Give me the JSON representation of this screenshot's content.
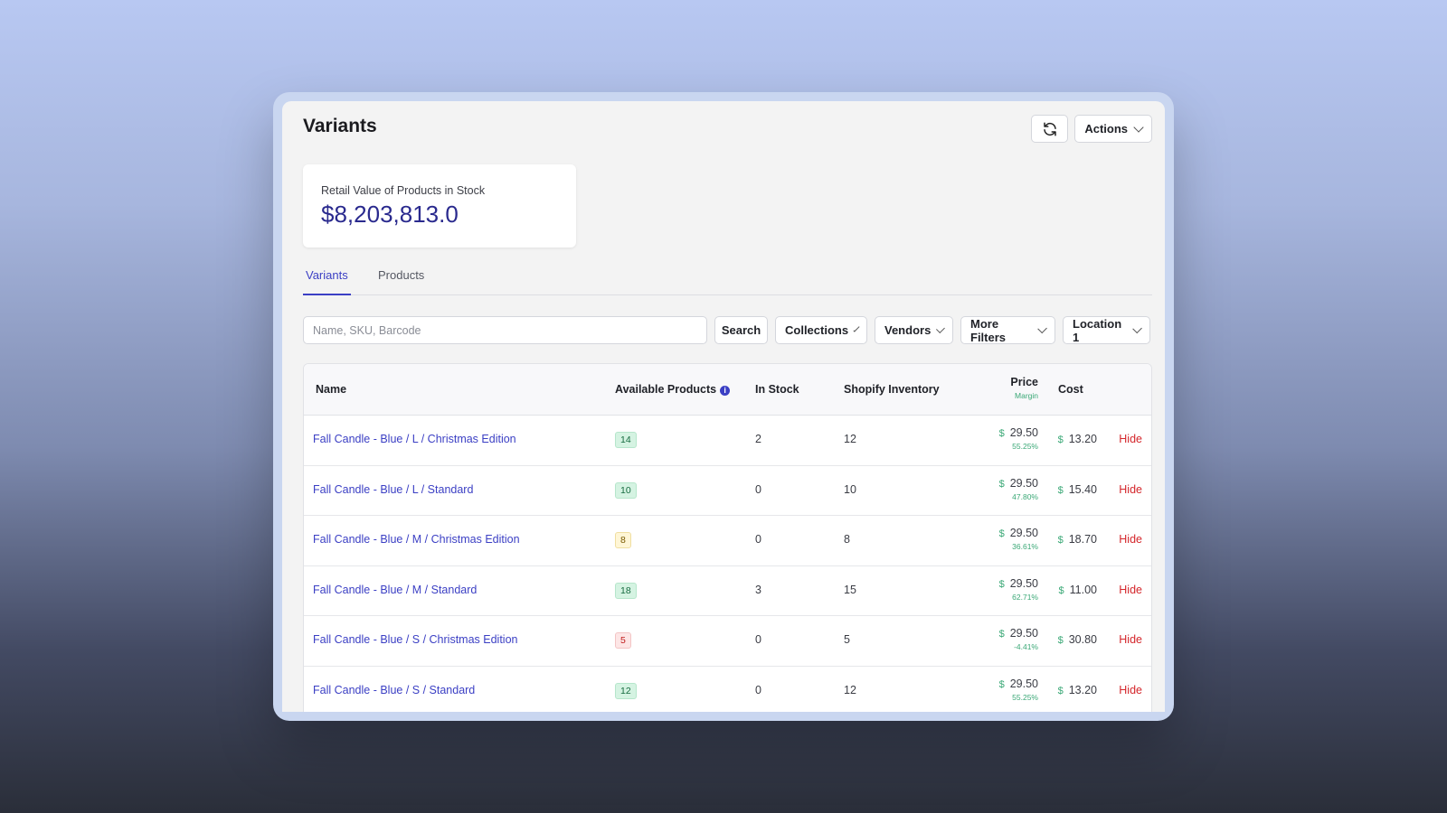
{
  "page": {
    "title": "Variants"
  },
  "toolbar": {
    "refresh_icon": "refresh-icon",
    "actions_label": "Actions"
  },
  "stat": {
    "label": "Retail Value of Products in Stock",
    "value": "$8,203,813.0"
  },
  "tabs": [
    {
      "label": "Variants",
      "active": true
    },
    {
      "label": "Products",
      "active": false
    }
  ],
  "filters": {
    "search_placeholder": "Name, SKU, Barcode",
    "search_label": "Search",
    "collections_label": "Collections",
    "vendors_label": "Vendors",
    "more_filters_label": "More Filters",
    "location_label": "Location 1"
  },
  "table": {
    "headers": {
      "name": "Name",
      "available": "Available Products",
      "in_stock": "In Stock",
      "shopify_inventory": "Shopify Inventory",
      "price": "Price",
      "margin": "Margin",
      "cost": "Cost"
    },
    "currency": "$",
    "hide_label": "Hide",
    "rows": [
      {
        "name": "Fall Candle - Blue / L / Christmas Edition",
        "available": "14",
        "status": "green",
        "in_stock": "2",
        "shopify_inventory": "12",
        "price": "29.50",
        "margin": "55.25%",
        "cost": "13.20"
      },
      {
        "name": "Fall Candle - Blue / L / Standard",
        "available": "10",
        "status": "green",
        "in_stock": "0",
        "shopify_inventory": "10",
        "price": "29.50",
        "margin": "47.80%",
        "cost": "15.40"
      },
      {
        "name": "Fall Candle - Blue / M / Christmas Edition",
        "available": "8",
        "status": "yellow",
        "in_stock": "0",
        "shopify_inventory": "8",
        "price": "29.50",
        "margin": "36.61%",
        "cost": "18.70"
      },
      {
        "name": "Fall Candle - Blue / M / Standard",
        "available": "18",
        "status": "green",
        "in_stock": "3",
        "shopify_inventory": "15",
        "price": "29.50",
        "margin": "62.71%",
        "cost": "11.00"
      },
      {
        "name": "Fall Candle - Blue / S / Christmas Edition",
        "available": "5",
        "status": "red",
        "in_stock": "0",
        "shopify_inventory": "5",
        "price": "29.50",
        "margin": "-4.41%",
        "cost": "30.80"
      },
      {
        "name": "Fall Candle - Blue / S / Standard",
        "available": "12",
        "status": "green",
        "in_stock": "0",
        "shopify_inventory": "12",
        "price": "29.50",
        "margin": "55.25%",
        "cost": "13.20"
      }
    ]
  },
  "colors": {
    "accent": "#3b3fc4",
    "positive": "#3aa876",
    "danger": "#d4262b",
    "stat_value": "#2a2a8e"
  }
}
